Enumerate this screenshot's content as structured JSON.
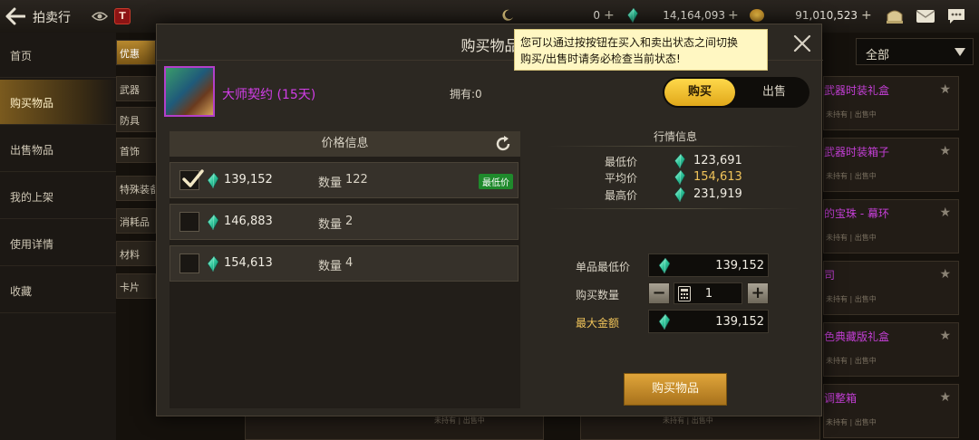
{
  "topbar": {
    "title": "拍卖行",
    "badge": "T",
    "currency1": "0",
    "currency2": "14,164,093",
    "currency3": "91,010,523"
  },
  "nav": {
    "items": [
      "首页",
      "购买物品",
      "出售物品",
      "我的上架",
      "使用详情",
      "收藏"
    ],
    "active": "购买物品",
    "sub_items": [
      "优惠",
      "武器",
      "防具",
      "首饰",
      "特殊装备",
      "消耗品",
      "材料",
      "卡片"
    ]
  },
  "right_list": {
    "dropdown": "全部",
    "cards": [
      {
        "name": "武器时装礼盒",
        "status": "未持有 | 出售中"
      },
      {
        "name": "武器时装箱子",
        "status": "未持有 | 出售中"
      },
      {
        "name": "的宝珠 - 幕环",
        "status": "未持有 | 出售中"
      },
      {
        "name": "司",
        "status": "未持有 | 出售中"
      },
      {
        "name": "色典藏版礼盒",
        "status": "未持有 | 出售中"
      },
      {
        "name": "调整箱",
        "status": "未持有 | 出售中"
      }
    ],
    "bottom_status_1": "未持有 | 出售中",
    "bottom_status_2": "未持有 | 出售中"
  },
  "modal": {
    "title": "购买物品",
    "tooltip_line1": "您可以通过按按钮在买入和卖出状态之间切换",
    "tooltip_line2": "购买/出售时请务必检查当前状态!",
    "item_name": "大师契约 (15天)",
    "owned": "拥有:0",
    "toggle_buy": "购买",
    "toggle_sell": "出售",
    "price_header": "价格信息",
    "qty_label": "数量",
    "lowest_badge": "最低价",
    "listings": [
      {
        "price": "139,152",
        "qty": "122",
        "checked": true
      },
      {
        "price": "146,883",
        "qty": "2",
        "checked": false
      },
      {
        "price": "154,613",
        "qty": "4",
        "checked": false
      }
    ],
    "market": {
      "title": "行情信息",
      "min_label": "最低价",
      "min": "123,691",
      "avg_label": "平均价",
      "avg": "154,613",
      "max_label": "最高价",
      "max": "231,919"
    },
    "form": {
      "unit_label": "单品最低价",
      "unit_price": "139,152",
      "qty_label": "购买数量",
      "qty": "1",
      "total_label": "最大金额",
      "total": "139,152"
    },
    "buy_button": "购买物品"
  },
  "colors": {
    "accent": "#f1c45a",
    "item_name": "#d23ee8",
    "lowest_badge": "#1f8a2c"
  }
}
